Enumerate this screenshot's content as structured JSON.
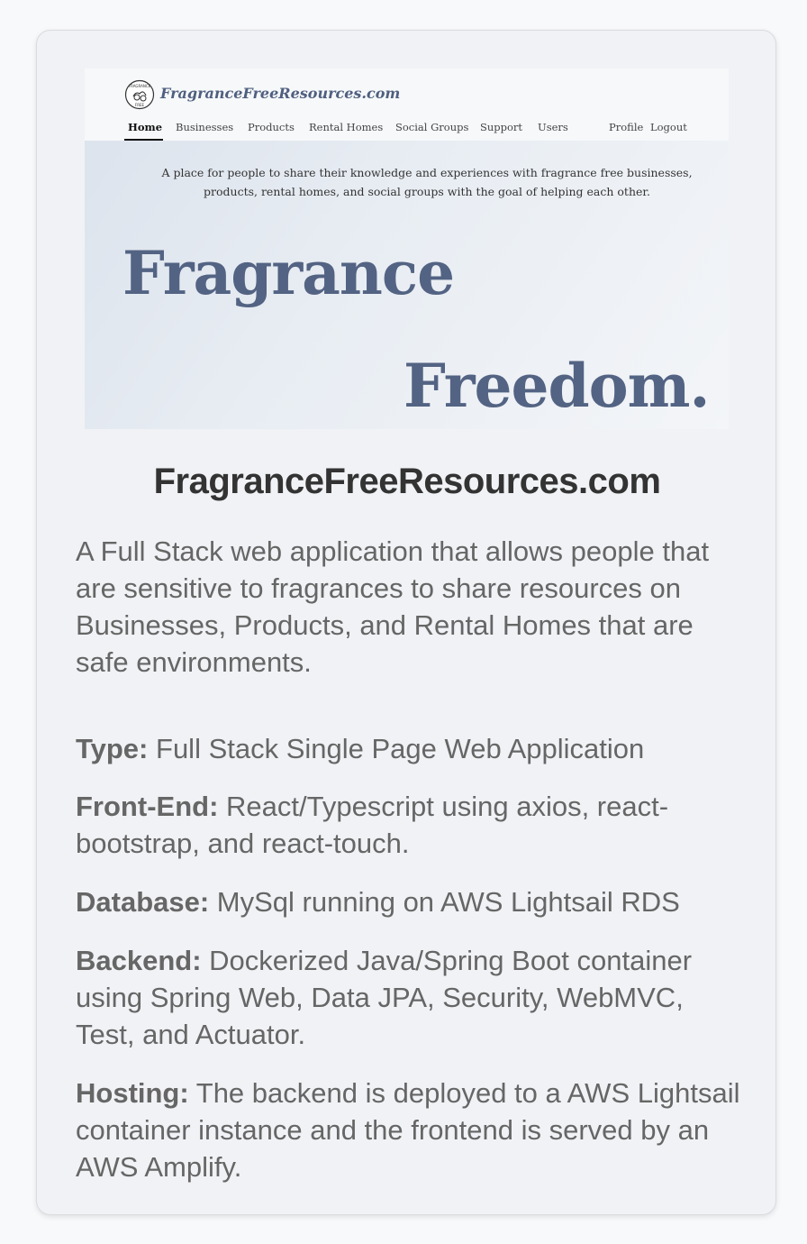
{
  "preview": {
    "brand": "FragranceFreeResources.com",
    "logo_text_top": "FRAGRANCE",
    "logo_text_bottom": "FREE",
    "nav": [
      {
        "label": "Home",
        "active": true
      },
      {
        "label": "Businesses"
      },
      {
        "label": "Products"
      },
      {
        "label": "Rental Homes"
      },
      {
        "label": "Social Groups"
      },
      {
        "label": "Support"
      },
      {
        "label": "Users"
      }
    ],
    "nav_right": [
      {
        "label": "Profile"
      },
      {
        "label": "Logout"
      }
    ],
    "tagline_line1": "A place for people to share their knowledge and experiences with fragrance free businesses,",
    "tagline_line2": "products, rental homes, and social groups with the goal of helping each other.",
    "hero_line1": "Fragrance",
    "hero_line2": "Freedom."
  },
  "card": {
    "title": "FragranceFreeResources.com",
    "description": "A Full Stack web application that allows people that are sensitive to fragrances to share resources on Businesses, Products, and Rental Homes that are safe environments.",
    "specs": [
      {
        "label": "Type:",
        "value": " Full Stack Single Page Web Application"
      },
      {
        "label": "Front-End:",
        "value": " React/Typescript using axios, react-bootstrap, and react-touch."
      },
      {
        "label": "Database:",
        "value": " MySql running on AWS Lightsail RDS"
      },
      {
        "label": "Backend:",
        "value": " Dockerized Java/Spring Boot container using Spring Web, Data JPA, Security, WebMVC, Test, and Actuator."
      },
      {
        "label": "Hosting:",
        "value": " The backend is deployed to a AWS Lightsail container instance and the frontend is served by an AWS Amplify."
      }
    ]
  },
  "colors": {
    "card_bg": "#f0f2f5",
    "hero_text": "#536383",
    "body_text": "#666666",
    "title_text": "#333333"
  }
}
